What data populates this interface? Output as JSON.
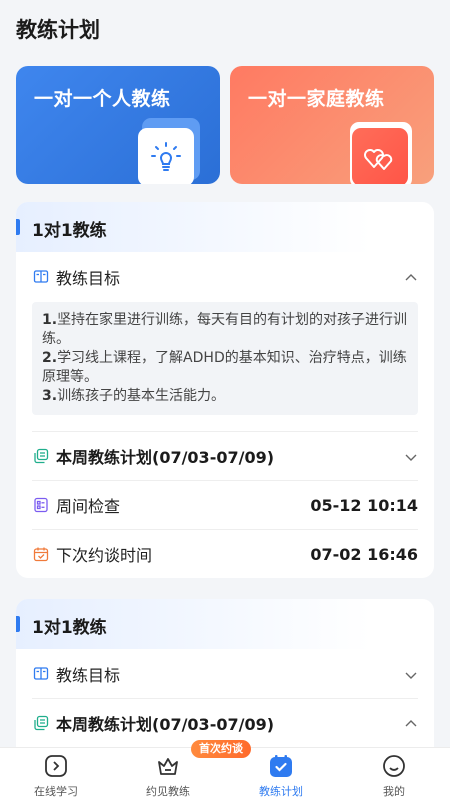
{
  "page": {
    "title": "教练计划"
  },
  "banners": [
    {
      "label": "一对一个人教练",
      "icon": "lightbulb-icon",
      "color": "#2f7bf0"
    },
    {
      "label": "一对一家庭教练",
      "icon": "hearts-icon",
      "color": "#ff7a62"
    }
  ],
  "cards": [
    {
      "title": "1对1教练",
      "goals_label": "教练目标",
      "goals": [
        {
          "num": "1.",
          "text": "坚持在家里进行训练，每天有目的有计划的对孩子进行训练。"
        },
        {
          "num": "2.",
          "text": "学习线上课程，了解ADHD的基本知识、治疗特点，训练原理等。"
        },
        {
          "num": "3.",
          "text": "训练孩子的基本生活能力。"
        }
      ],
      "weekly_plan": "本周教练计划(07/03-07/09)",
      "weekly_check_label": "周间检查",
      "weekly_check_time": "05-12 10:14",
      "next_appt_label": "下次约谈时间",
      "next_appt_time": "07-02 16:46"
    },
    {
      "title": "1对1教练",
      "goals_label": "教练目标",
      "weekly_plan": "本周教练计划(07/03-07/09)"
    }
  ],
  "tabbar": {
    "items": [
      {
        "label": "在线学习",
        "icon": "play-icon"
      },
      {
        "label": "约见教练",
        "icon": "crown-icon"
      },
      {
        "label": "教练计划",
        "icon": "calendar-check-icon",
        "active": true
      },
      {
        "label": "我的",
        "icon": "smile-icon"
      }
    ],
    "badge": "首次约谈",
    "accent": "#2f7bf0"
  }
}
